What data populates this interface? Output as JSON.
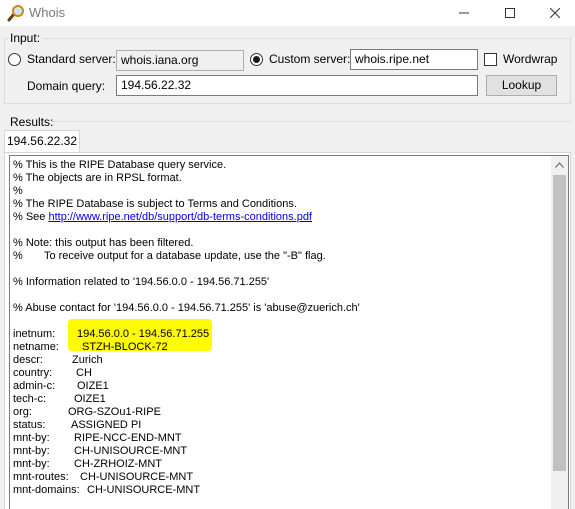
{
  "window": {
    "title": "Whois"
  },
  "input_group": {
    "label": "Input:",
    "standard_server_label": "Standard server:",
    "standard_server_value": "whois.iana.org",
    "custom_server_label": "Custom server:",
    "custom_server_value": "whois.ripe.net",
    "custom_server_selected": true,
    "wordwrap_label": "Wordwrap",
    "wordwrap_checked": false,
    "domain_query_label": "Domain query:",
    "domain_query_value": "194.56.22.32",
    "lookup_button": "Lookup"
  },
  "results": {
    "label": "Results:",
    "tab_label": "194.56.22.32",
    "text_lines": [
      "% This is the RIPE Database query service.",
      "% The objects are in RPSL format.",
      "%",
      "% The RIPE Database is subject to Terms and Conditions.",
      "% See ",
      "",
      "% Note: this output has been filtered.",
      "%       To receive output for a database update, use the \"-B\" flag.",
      "",
      "% Information related to '194.56.0.0 - 194.56.71.255'",
      "",
      "% Abuse contact for '194.56.0.0 - 194.56.71.255' is 'abuse@zuerich.ch'",
      ""
    ],
    "terms_link": "http://www.ripe.net/db/support/db-terms-conditions.pdf",
    "fields": [
      {
        "key": "inetnum:",
        "value": "194.56.0.0 - 194.56.71.255"
      },
      {
        "key": "netname:",
        "value": "STZH-BLOCK-72"
      },
      {
        "key": "descr:",
        "value": "Zurich"
      },
      {
        "key": "country:",
        "value": "CH"
      },
      {
        "key": "admin-c:",
        "value": "OIZE1"
      },
      {
        "key": "tech-c:",
        "value": "OIZE1"
      },
      {
        "key": "org:",
        "value": "ORG-SZOu1-RIPE"
      },
      {
        "key": "status:",
        "value": "ASSIGNED PI"
      },
      {
        "key": "mnt-by:",
        "value": "RIPE-NCC-END-MNT"
      },
      {
        "key": "mnt-by:",
        "value": "CH-UNISOURCE-MNT"
      },
      {
        "key": "mnt-by:",
        "value": "CH-ZRHOIZ-MNT"
      },
      {
        "key": "mnt-routes:",
        "value": "CH-UNISOURCE-MNT"
      },
      {
        "key": "mnt-domains:",
        "value": "CH-UNISOURCE-MNT"
      }
    ]
  },
  "colors": {
    "highlight": "#fffb00",
    "link": "#0000ee",
    "title_text": "#7a7a7a"
  },
  "icons": {
    "app": "magnifier-icon",
    "minimize": "minimize-icon",
    "maximize": "maximize-icon",
    "close": "close-icon",
    "scroll_up": "chevron-up-icon"
  }
}
